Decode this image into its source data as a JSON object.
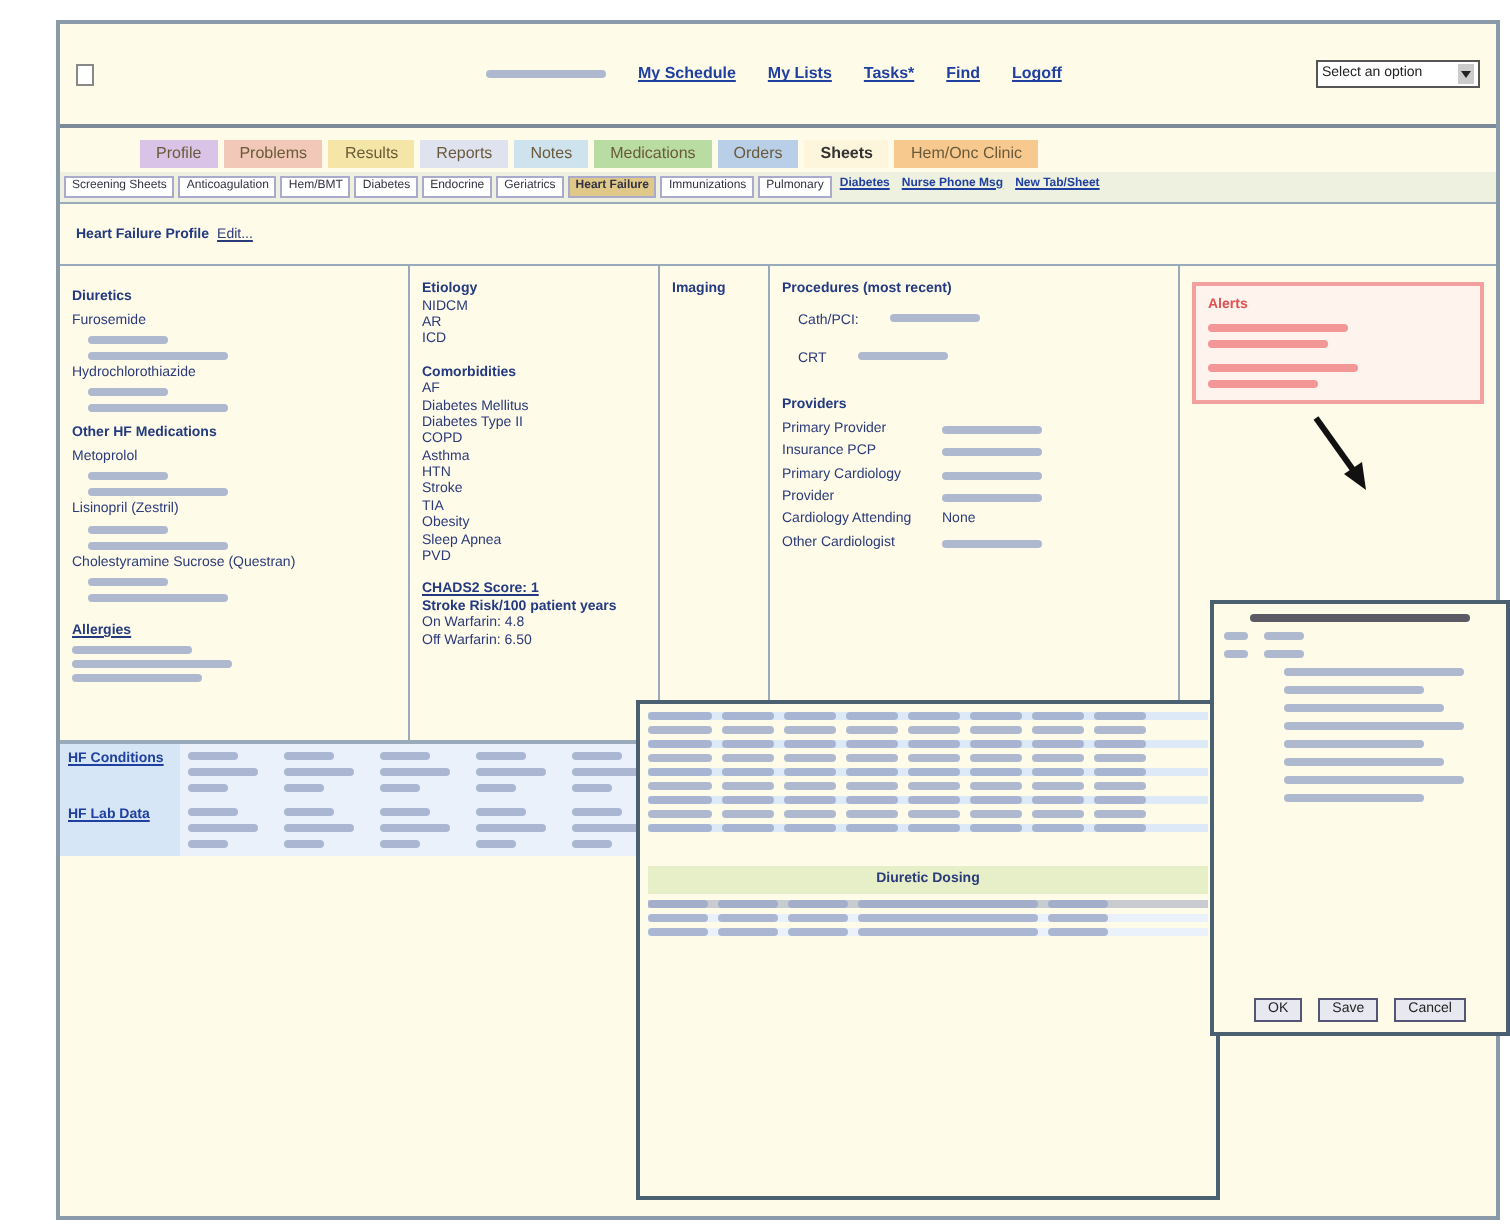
{
  "header": {
    "links": [
      "My Schedule",
      "My Lists",
      "Tasks*",
      "Find",
      "Logoff"
    ],
    "select": {
      "value": "Select an option"
    }
  },
  "tabs": [
    {
      "label": "Profile",
      "color": "#d9c3e6",
      "selected": false
    },
    {
      "label": "Problems",
      "color": "#f2c9b8",
      "selected": false
    },
    {
      "label": "Results",
      "color": "#f5e6a8",
      "selected": false
    },
    {
      "label": "Reports",
      "color": "#dfe3f0",
      "selected": false
    },
    {
      "label": "Notes",
      "color": "#cfe3ee",
      "selected": false
    },
    {
      "label": "Medications",
      "color": "#b9dca2",
      "selected": false
    },
    {
      "label": "Orders",
      "color": "#b9cfe8",
      "selected": false
    },
    {
      "label": "Sheets",
      "color": "#fdf6dc",
      "selected": true
    },
    {
      "label": "Hem/Onc Clinic",
      "color": "#f7c98f",
      "selected": false
    }
  ],
  "subtabs": [
    {
      "label": "Screening Sheets",
      "kind": "tab",
      "selected": false
    },
    {
      "label": "Anticoagulation",
      "kind": "tab",
      "selected": false
    },
    {
      "label": "Hem/BMT",
      "kind": "tab",
      "selected": false
    },
    {
      "label": "Diabetes",
      "kind": "tab",
      "selected": false
    },
    {
      "label": "Endocrine",
      "kind": "tab",
      "selected": false
    },
    {
      "label": "Geriatrics",
      "kind": "tab",
      "selected": false
    },
    {
      "label": "Heart Failure",
      "kind": "tab",
      "selected": true
    },
    {
      "label": "Immunizations",
      "kind": "tab",
      "selected": false
    },
    {
      "label": "Pulmonary",
      "kind": "tab",
      "selected": false
    },
    {
      "label": "Diabetes",
      "kind": "link"
    },
    {
      "label": "Nurse Phone Msg",
      "kind": "link"
    },
    {
      "label": "New Tab/Sheet",
      "kind": "link"
    }
  ],
  "profile": {
    "title": "Heart Failure Profile",
    "edit": "Edit..."
  },
  "medications": [
    {
      "heading": "Diuretics",
      "drugs": [
        "Furosemide",
        "Hydrochlorothiazide"
      ]
    },
    {
      "heading": "Other HF Medications",
      "drugs": [
        "Metoprolol",
        "Lisinopril (Zestril)",
        "Cholestyramine Sucrose (Questran)"
      ]
    }
  ],
  "allergies": {
    "heading": "Allergies"
  },
  "etiology": {
    "heading": "Etiology",
    "items": [
      "NIDCM",
      "AR",
      "ICD"
    ]
  },
  "comorbidities": {
    "heading": "Comorbidities",
    "items": [
      "AF",
      "Diabetes Mellitus",
      "Diabetes Type II",
      "COPD",
      "Asthma",
      "HTN",
      "Stroke",
      "TIA",
      "Obesity",
      "Sleep Apnea",
      "PVD"
    ]
  },
  "risk": {
    "score": "CHADS2 Score: 1",
    "risk_label": "Stroke Risk/100 patient years",
    "on": "On Warfarin: 4.8",
    "off": "Off Warfarin: 6.50"
  },
  "imaging": {
    "heading": "Imaging"
  },
  "procedures": {
    "heading": "Procedures (most recent)",
    "items": [
      {
        "label": "Cath/PCI:"
      },
      {
        "label": "CRT"
      }
    ]
  },
  "providers": {
    "heading": "Providers",
    "rows": [
      {
        "role": "Primary Provider"
      },
      {
        "role": "Insurance PCP"
      },
      {
        "role": "Primary Cardiology"
      },
      {
        "role": "Provider"
      },
      {
        "role": "Cardiology Attending",
        "value": "None"
      },
      {
        "role": "Other Cardiologist"
      }
    ]
  },
  "alerts": {
    "heading": "Alerts"
  },
  "table": {
    "rows": [
      {
        "label": "HF Conditions"
      },
      {
        "label": "HF Lab Data"
      }
    ]
  },
  "overlay": {
    "section": "Diuretic Dosing"
  },
  "dialog": {
    "buttons": [
      "OK",
      "Save",
      "Cancel"
    ]
  }
}
